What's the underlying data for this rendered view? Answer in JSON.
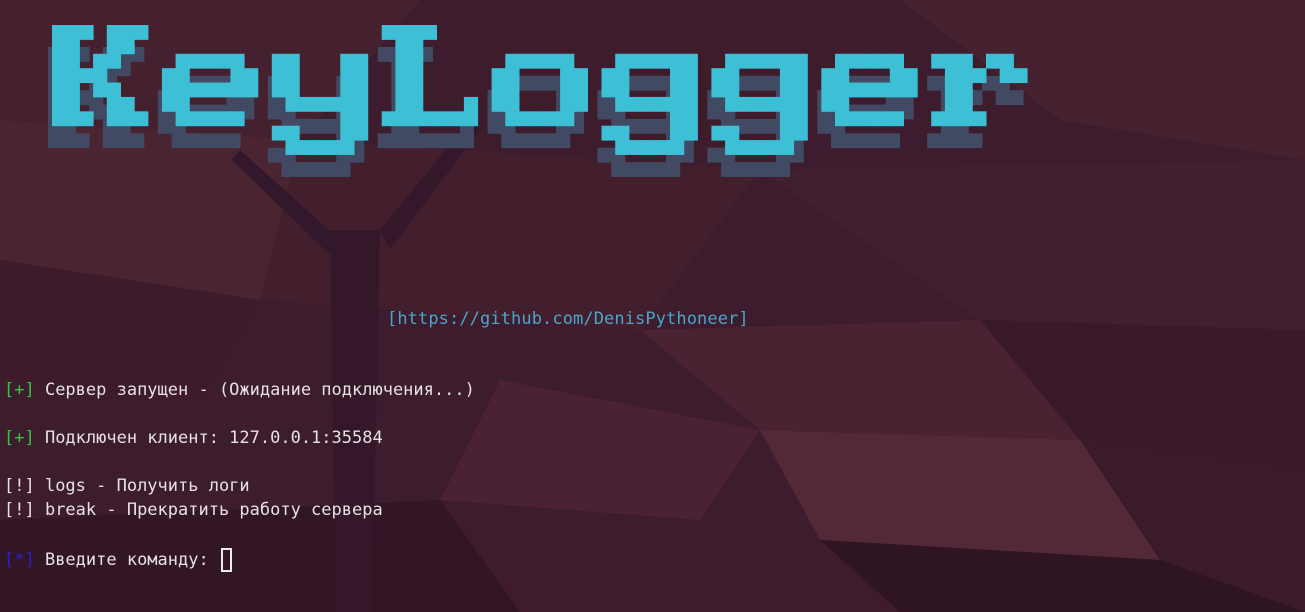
{
  "banner": {
    "title": "KeyLogger",
    "url": "[https://github.com/DenisPythoneer]"
  },
  "terminal": {
    "lines": [
      {
        "tag": "[+]",
        "text": " Сервер запущен - (Ожидание подключения...)"
      },
      {
        "tag": "[+]",
        "text": " Подключен клиент: 127.0.0.1:35584"
      },
      {
        "tag": "[!]",
        "text": " logs - Получить логи"
      },
      {
        "tag": "[!]",
        "text": " break - Прекратить работу сервера"
      },
      {
        "tag": "[*]",
        "text": " Введите команду: "
      }
    ]
  },
  "colors": {
    "logo": "#3dbfd6",
    "logo_shadow": "#414a62",
    "tag_plus": "#3cc23c",
    "tag_star": "#2323c9",
    "url": "#4aa6c9"
  }
}
